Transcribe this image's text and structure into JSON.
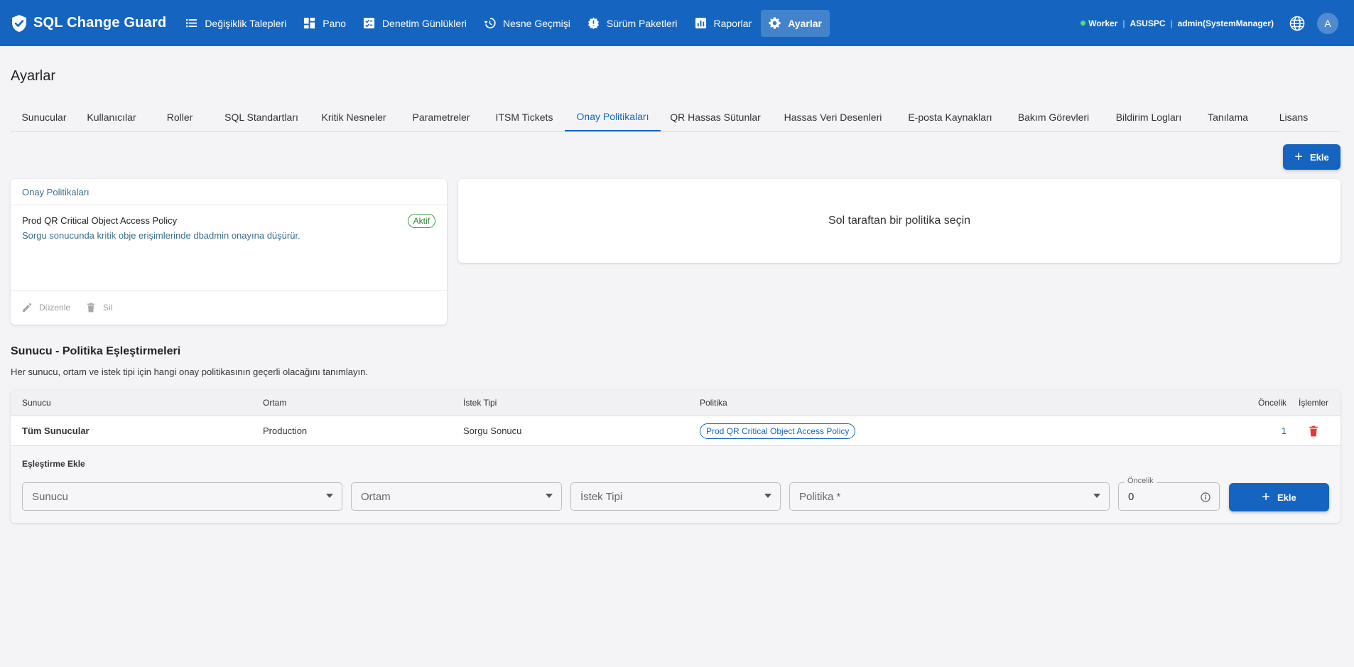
{
  "app": {
    "title": "SQL Change Guard"
  },
  "nav": [
    {
      "label": "Değişiklik Talepleri",
      "icon": "list-icon"
    },
    {
      "label": "Pano",
      "icon": "dashboard-icon"
    },
    {
      "label": "Denetim Günlükleri",
      "icon": "checklist-icon"
    },
    {
      "label": "Nesne Geçmişi",
      "icon": "history-icon"
    },
    {
      "label": "Sürüm Paketleri",
      "icon": "package-icon"
    },
    {
      "label": "Raporlar",
      "icon": "chart-icon"
    },
    {
      "label": "Ayarlar",
      "icon": "gear-icon",
      "active": true
    }
  ],
  "status": {
    "worker": "Worker",
    "host": "ASUSPC",
    "user": "admin(SystemManager)",
    "avatar": "A",
    "dot_color": "#4ade80"
  },
  "page": {
    "title": "Ayarlar"
  },
  "tabs": [
    "Sunucular",
    "Kullanıcılar",
    "Roller",
    "SQL Standartları",
    "Kritik Nesneler",
    "Parametreler",
    "ITSM Tickets",
    "Onay Politikaları",
    "QR Hassas Sütunlar",
    "Hassas Veri Desenleri",
    "E-posta Kaynakları",
    "Bakım Görevleri",
    "Bildirim Logları",
    "Tanılama",
    "Lisans"
  ],
  "active_tab": "Onay Politikaları",
  "toolbar": {
    "add_label": "Ekle"
  },
  "policies": {
    "header": "Onay Politikaları",
    "items": [
      {
        "name": "Prod QR Critical Object Access Policy",
        "description": "Sorgu sonucunda kritik obje erişimlerinde dbadmin onayına düşürür.",
        "status": "Aktif"
      }
    ],
    "edit_label": "Düzenle",
    "delete_label": "Sil"
  },
  "detail": {
    "empty_text": "Sol taraftan bir politika seçin"
  },
  "mappings": {
    "title": "Sunucu - Politika Eşleştirmeleri",
    "subtitle": "Her sunucu, ortam ve istek tipi için hangi onay politikasının geçerli olacağını tanımlayın.",
    "columns": [
      "Sunucu",
      "Ortam",
      "İstek Tipi",
      "Politika",
      "Öncelik",
      "İşlemler"
    ],
    "rows": [
      {
        "server": "Tüm Sunucular",
        "env": "Production",
        "request_type": "Sorgu Sonucu",
        "policy": "Prod QR Critical Object Access Policy",
        "priority": "1"
      }
    ],
    "add": {
      "title": "Eşleştirme Ekle",
      "server_placeholder": "Sunucu",
      "env_placeholder": "Ortam",
      "type_placeholder": "İstek Tipi",
      "policy_placeholder": "Politika *",
      "priority_label": "Öncelik",
      "priority_value": "0",
      "button_label": "Ekle"
    }
  },
  "colors": {
    "primary": "#1565c0",
    "success": "#43a047",
    "danger": "#e53935"
  }
}
